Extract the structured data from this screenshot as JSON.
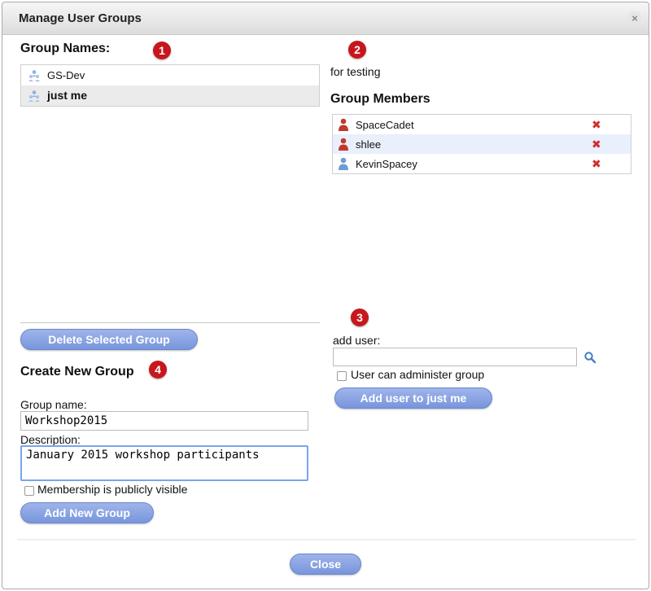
{
  "window": {
    "title": "Manage User Groups",
    "close_glyph": "×"
  },
  "badges": [
    "1",
    "2",
    "3",
    "4"
  ],
  "groups": {
    "heading": "Group Names:",
    "items": [
      {
        "name": "GS-Dev",
        "selected": false
      },
      {
        "name": "just me",
        "selected": true
      }
    ],
    "delete_button": "Delete Selected Group"
  },
  "selected_group": {
    "description": "for testing",
    "members_heading": "Group Members",
    "members": [
      {
        "name": "SpaceCadet",
        "role": "admin",
        "remove": "✖"
      },
      {
        "name": "shlee",
        "role": "admin",
        "remove": "✖"
      },
      {
        "name": "KevinSpacey",
        "role": "member",
        "remove": "✖"
      }
    ]
  },
  "add_user": {
    "label": "add user:",
    "input_value": "",
    "admin_checkbox_label": "User can administer group",
    "button": "Add user to just me"
  },
  "create_group": {
    "heading": "Create New Group",
    "name_label": "Group name:",
    "name_value": "Workshop2015",
    "description_label": "Description:",
    "description_value": "January 2015 workshop participants",
    "public_checkbox_label": "Membership is publicly visible",
    "button": "Add New Group"
  },
  "footer": {
    "close_button": "Close"
  },
  "colors": {
    "badge": "#c8161d",
    "button": "#7f9be0",
    "admin_user": "#c0392b",
    "member_user": "#6f9bd8",
    "remove": "#d62c2c"
  }
}
